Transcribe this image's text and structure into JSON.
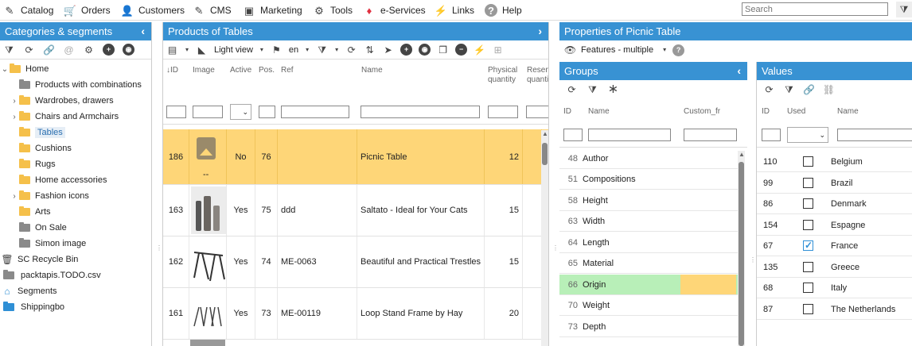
{
  "menu": [
    {
      "label": "Catalog",
      "icon": "pencil-icon"
    },
    {
      "label": "Orders",
      "icon": "cart-icon"
    },
    {
      "label": "Customers",
      "icon": "user-icon"
    },
    {
      "label": "CMS",
      "icon": "edit-icon"
    },
    {
      "label": "Marketing",
      "icon": "ticket-icon"
    },
    {
      "label": "Tools",
      "icon": "gear-icon"
    },
    {
      "label": "e-Services",
      "icon": "gem-icon"
    },
    {
      "label": "Links",
      "icon": "bolt-icon"
    },
    {
      "label": "Help",
      "icon": "help-icon"
    }
  ],
  "search": {
    "placeholder": "Search"
  },
  "categories": {
    "title": "Categories & segments",
    "items": [
      {
        "label": "Home",
        "level": 0,
        "arrow": "down",
        "folder": "open"
      },
      {
        "label": "Products with combinations",
        "level": 1,
        "arrow": "",
        "folder": "grey"
      },
      {
        "label": "Wardrobes, drawers",
        "level": 1,
        "arrow": "right",
        "folder": "yellow"
      },
      {
        "label": "Chairs and Armchairs",
        "level": 1,
        "arrow": "right",
        "folder": "yellow"
      },
      {
        "label": "Tables",
        "level": 1,
        "arrow": "",
        "folder": "yellow",
        "selected": true
      },
      {
        "label": "Cushions",
        "level": 1,
        "arrow": "",
        "folder": "yellow"
      },
      {
        "label": "Rugs",
        "level": 1,
        "arrow": "",
        "folder": "yellow"
      },
      {
        "label": "Home accessories",
        "level": 1,
        "arrow": "",
        "folder": "yellow"
      },
      {
        "label": "Fashion icons",
        "level": 1,
        "arrow": "right",
        "folder": "yellow"
      },
      {
        "label": "Arts",
        "level": 1,
        "arrow": "",
        "folder": "yellow"
      },
      {
        "label": "On Sale",
        "level": 1,
        "arrow": "",
        "folder": "grey"
      },
      {
        "label": "Simon image",
        "level": 1,
        "arrow": "",
        "folder": "grey"
      },
      {
        "label": "SC Recycle Bin",
        "level": 0,
        "arrow": "",
        "folder": "trash"
      },
      {
        "label": "packtapis.TODO.csv",
        "level": 0,
        "arrow": "",
        "folder": "grey"
      },
      {
        "label": "Segments",
        "level": 0,
        "arrow": "",
        "folder": "segments"
      },
      {
        "label": "Shippingbo",
        "level": 0,
        "arrow": "",
        "folder": "blue"
      }
    ]
  },
  "products": {
    "title": "Products of Tables",
    "view": "Light view",
    "lang": "en",
    "columns": [
      "ID",
      "Image",
      "Active",
      "Pos.",
      "Ref",
      "Name",
      "Physical quantity",
      "Reserved quantity"
    ],
    "rows": [
      {
        "id": "186",
        "image": "--",
        "active": "No",
        "pos": "76",
        "ref": "",
        "name": "Picnic Table",
        "qty": "12",
        "selected": true
      },
      {
        "id": "163",
        "image": "",
        "active": "Yes",
        "pos": "75",
        "ref": "ddd",
        "name": "Saltato - Ideal for Your Cats",
        "qty": "15"
      },
      {
        "id": "162",
        "image": "",
        "active": "Yes",
        "pos": "74",
        "ref": "ME-0063",
        "name": "Beautiful and Practical Trestles",
        "qty": "15"
      },
      {
        "id": "161",
        "image": "",
        "active": "Yes",
        "pos": "73",
        "ref": "ME-00119",
        "name": "Loop Stand Frame by Hay",
        "qty": "20"
      }
    ]
  },
  "properties": {
    "title": "Properties of Picnic Table",
    "mode": "Features - multiple"
  },
  "groups": {
    "title": "Groups",
    "columns": [
      "ID",
      "Name",
      "Custom_fr"
    ],
    "rows": [
      {
        "id": "48",
        "name": "Author"
      },
      {
        "id": "51",
        "name": "Compositions"
      },
      {
        "id": "58",
        "name": "Height"
      },
      {
        "id": "63",
        "name": "Width"
      },
      {
        "id": "64",
        "name": "Length"
      },
      {
        "id": "65",
        "name": "Material"
      },
      {
        "id": "66",
        "name": "Origin",
        "selected": true
      },
      {
        "id": "70",
        "name": "Weight"
      },
      {
        "id": "73",
        "name": "Depth"
      }
    ]
  },
  "values": {
    "title": "Values",
    "columns": [
      "ID",
      "Used",
      "Name"
    ],
    "rows": [
      {
        "id": "110",
        "used": false,
        "name": "Belgium"
      },
      {
        "id": "99",
        "used": false,
        "name": "Brazil"
      },
      {
        "id": "86",
        "used": false,
        "name": "Denmark"
      },
      {
        "id": "154",
        "used": false,
        "name": "Espagne"
      },
      {
        "id": "67",
        "used": true,
        "name": "France"
      },
      {
        "id": "135",
        "used": false,
        "name": "Greece"
      },
      {
        "id": "68",
        "used": false,
        "name": "Italy"
      },
      {
        "id": "87",
        "used": false,
        "name": "The Netherlands"
      }
    ]
  },
  "colors": {
    "header": "#3892d3",
    "selected_row": "#fed678",
    "selected_group": "#b8efb8"
  }
}
